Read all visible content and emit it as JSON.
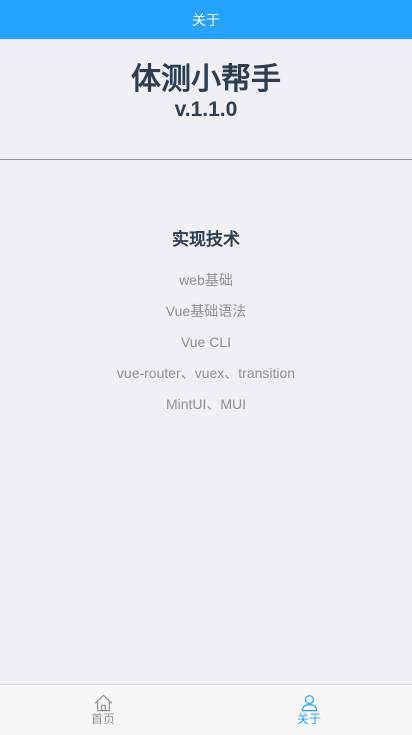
{
  "header": {
    "title": "关于"
  },
  "hero": {
    "name": "体测小帮手",
    "version": "v.1.1.0"
  },
  "tech": {
    "title": "实现技术",
    "items": [
      "web基础",
      "Vue基础语法",
      "Vue CLI",
      "vue-router、vuex、transition",
      "MintUI、MUI"
    ]
  },
  "tabbar": {
    "items": [
      {
        "label": "首页",
        "icon": "home-icon",
        "active": false
      },
      {
        "label": "关于",
        "icon": "user-icon",
        "active": true
      }
    ]
  },
  "colors": {
    "accent": "#26a2ff",
    "background": "#efeff4",
    "title_text": "#2c3e50",
    "muted_text": "#8f8f94",
    "inactive_tab": "#929292"
  }
}
